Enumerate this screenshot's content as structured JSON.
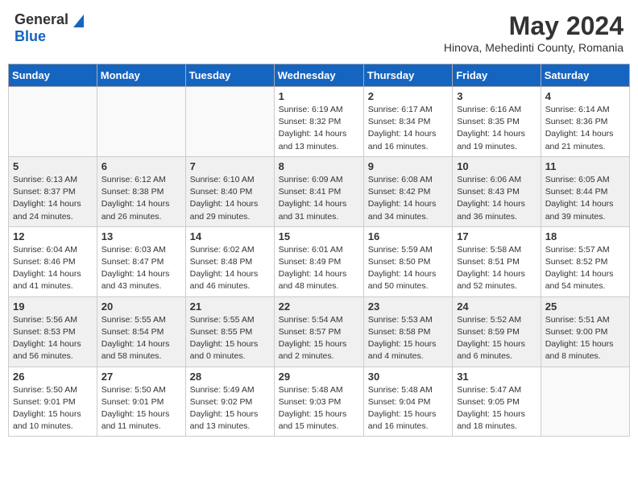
{
  "logo": {
    "general": "General",
    "blue": "Blue"
  },
  "title": {
    "month_year": "May 2024",
    "location": "Hinova, Mehedinti County, Romania"
  },
  "headers": [
    "Sunday",
    "Monday",
    "Tuesday",
    "Wednesday",
    "Thursday",
    "Friday",
    "Saturday"
  ],
  "weeks": [
    [
      {
        "day": "",
        "info": ""
      },
      {
        "day": "",
        "info": ""
      },
      {
        "day": "",
        "info": ""
      },
      {
        "day": "1",
        "info": "Sunrise: 6:19 AM\nSunset: 8:32 PM\nDaylight: 14 hours and 13 minutes."
      },
      {
        "day": "2",
        "info": "Sunrise: 6:17 AM\nSunset: 8:34 PM\nDaylight: 14 hours and 16 minutes."
      },
      {
        "day": "3",
        "info": "Sunrise: 6:16 AM\nSunset: 8:35 PM\nDaylight: 14 hours and 19 minutes."
      },
      {
        "day": "4",
        "info": "Sunrise: 6:14 AM\nSunset: 8:36 PM\nDaylight: 14 hours and 21 minutes."
      }
    ],
    [
      {
        "day": "5",
        "info": "Sunrise: 6:13 AM\nSunset: 8:37 PM\nDaylight: 14 hours and 24 minutes."
      },
      {
        "day": "6",
        "info": "Sunrise: 6:12 AM\nSunset: 8:38 PM\nDaylight: 14 hours and 26 minutes."
      },
      {
        "day": "7",
        "info": "Sunrise: 6:10 AM\nSunset: 8:40 PM\nDaylight: 14 hours and 29 minutes."
      },
      {
        "day": "8",
        "info": "Sunrise: 6:09 AM\nSunset: 8:41 PM\nDaylight: 14 hours and 31 minutes."
      },
      {
        "day": "9",
        "info": "Sunrise: 6:08 AM\nSunset: 8:42 PM\nDaylight: 14 hours and 34 minutes."
      },
      {
        "day": "10",
        "info": "Sunrise: 6:06 AM\nSunset: 8:43 PM\nDaylight: 14 hours and 36 minutes."
      },
      {
        "day": "11",
        "info": "Sunrise: 6:05 AM\nSunset: 8:44 PM\nDaylight: 14 hours and 39 minutes."
      }
    ],
    [
      {
        "day": "12",
        "info": "Sunrise: 6:04 AM\nSunset: 8:46 PM\nDaylight: 14 hours and 41 minutes."
      },
      {
        "day": "13",
        "info": "Sunrise: 6:03 AM\nSunset: 8:47 PM\nDaylight: 14 hours and 43 minutes."
      },
      {
        "day": "14",
        "info": "Sunrise: 6:02 AM\nSunset: 8:48 PM\nDaylight: 14 hours and 46 minutes."
      },
      {
        "day": "15",
        "info": "Sunrise: 6:01 AM\nSunset: 8:49 PM\nDaylight: 14 hours and 48 minutes."
      },
      {
        "day": "16",
        "info": "Sunrise: 5:59 AM\nSunset: 8:50 PM\nDaylight: 14 hours and 50 minutes."
      },
      {
        "day": "17",
        "info": "Sunrise: 5:58 AM\nSunset: 8:51 PM\nDaylight: 14 hours and 52 minutes."
      },
      {
        "day": "18",
        "info": "Sunrise: 5:57 AM\nSunset: 8:52 PM\nDaylight: 14 hours and 54 minutes."
      }
    ],
    [
      {
        "day": "19",
        "info": "Sunrise: 5:56 AM\nSunset: 8:53 PM\nDaylight: 14 hours and 56 minutes."
      },
      {
        "day": "20",
        "info": "Sunrise: 5:55 AM\nSunset: 8:54 PM\nDaylight: 14 hours and 58 minutes."
      },
      {
        "day": "21",
        "info": "Sunrise: 5:55 AM\nSunset: 8:55 PM\nDaylight: 15 hours and 0 minutes."
      },
      {
        "day": "22",
        "info": "Sunrise: 5:54 AM\nSunset: 8:57 PM\nDaylight: 15 hours and 2 minutes."
      },
      {
        "day": "23",
        "info": "Sunrise: 5:53 AM\nSunset: 8:58 PM\nDaylight: 15 hours and 4 minutes."
      },
      {
        "day": "24",
        "info": "Sunrise: 5:52 AM\nSunset: 8:59 PM\nDaylight: 15 hours and 6 minutes."
      },
      {
        "day": "25",
        "info": "Sunrise: 5:51 AM\nSunset: 9:00 PM\nDaylight: 15 hours and 8 minutes."
      }
    ],
    [
      {
        "day": "26",
        "info": "Sunrise: 5:50 AM\nSunset: 9:01 PM\nDaylight: 15 hours and 10 minutes."
      },
      {
        "day": "27",
        "info": "Sunrise: 5:50 AM\nSunset: 9:01 PM\nDaylight: 15 hours and 11 minutes."
      },
      {
        "day": "28",
        "info": "Sunrise: 5:49 AM\nSunset: 9:02 PM\nDaylight: 15 hours and 13 minutes."
      },
      {
        "day": "29",
        "info": "Sunrise: 5:48 AM\nSunset: 9:03 PM\nDaylight: 15 hours and 15 minutes."
      },
      {
        "day": "30",
        "info": "Sunrise: 5:48 AM\nSunset: 9:04 PM\nDaylight: 15 hours and 16 minutes."
      },
      {
        "day": "31",
        "info": "Sunrise: 5:47 AM\nSunset: 9:05 PM\nDaylight: 15 hours and 18 minutes."
      },
      {
        "day": "",
        "info": ""
      }
    ]
  ]
}
